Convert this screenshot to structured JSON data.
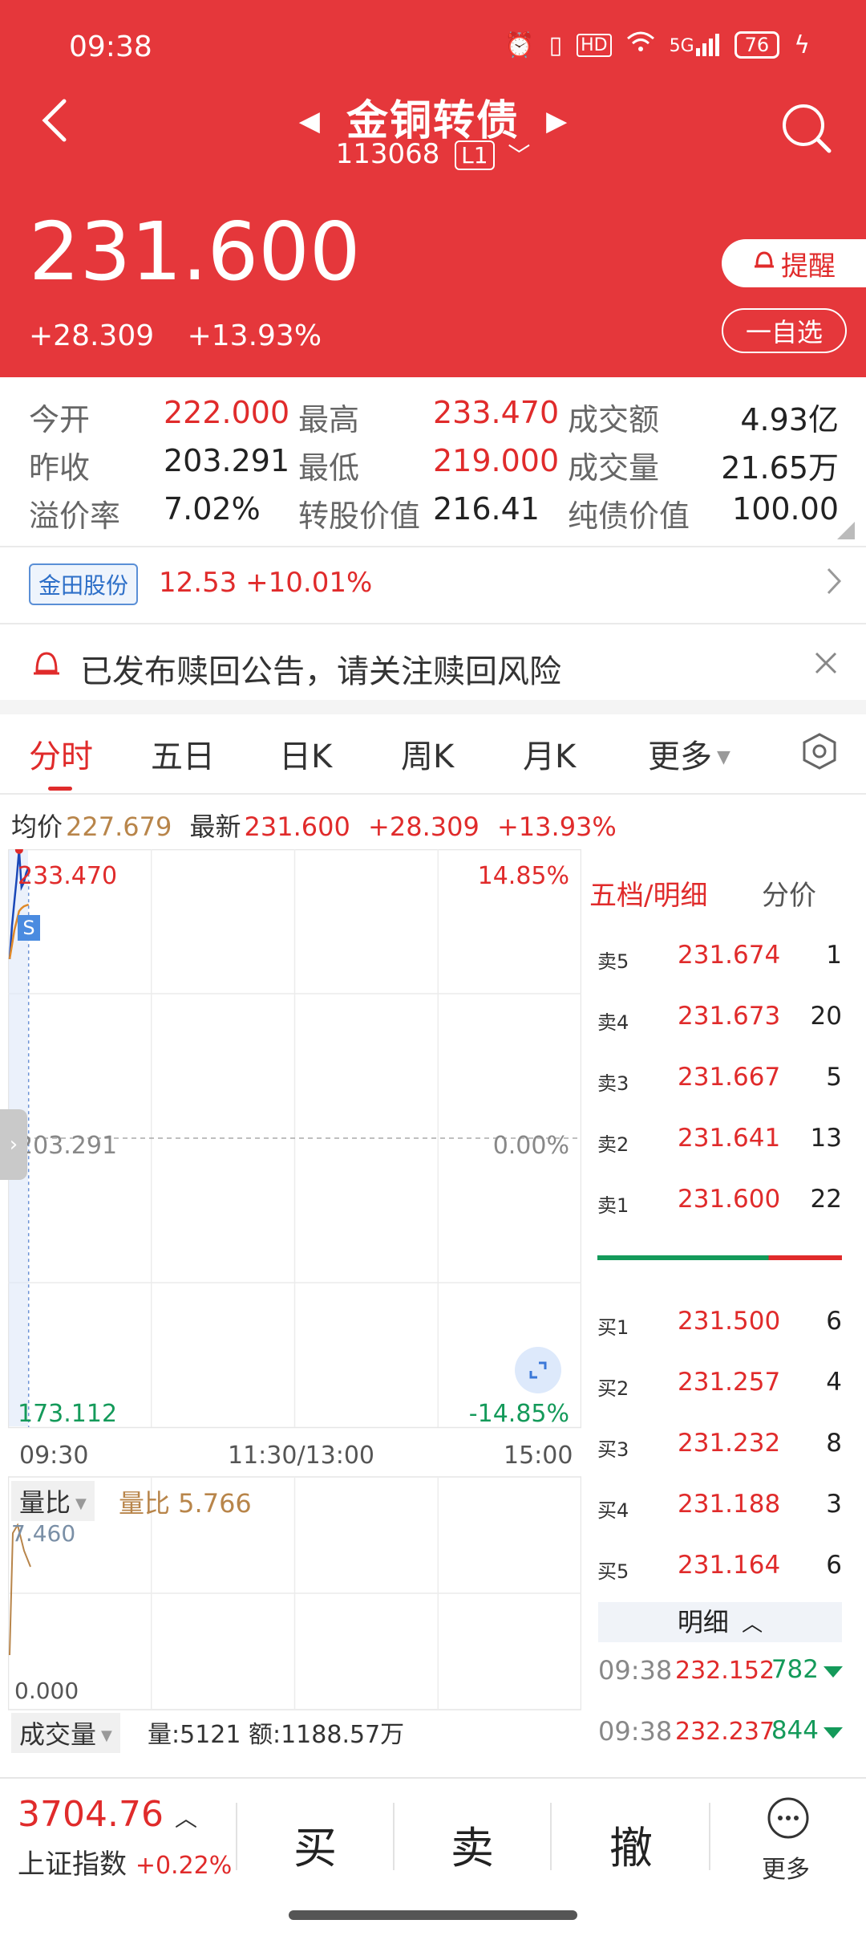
{
  "status_bar": {
    "time": "09:38",
    "net": "5G",
    "battery": "76"
  },
  "header": {
    "title": "金铜转债",
    "code": "113068",
    "level": "L1",
    "price": "231.600",
    "change": "+28.309",
    "change_pct": "+13.93%",
    "remind_label": "提醒",
    "watchlist_label": "一自选"
  },
  "stats": [
    [
      {
        "label": "今开",
        "value": "222.000",
        "color": "red"
      },
      {
        "label": "最高",
        "value": "233.470",
        "color": "red"
      },
      {
        "label": "成交额",
        "value": "4.93亿",
        "color": "black"
      }
    ],
    [
      {
        "label": "昨收",
        "value": "203.291",
        "color": "black"
      },
      {
        "label": "最低",
        "value": "219.000",
        "color": "red"
      },
      {
        "label": "成交量",
        "value": "21.65万",
        "color": "black"
      }
    ],
    [
      {
        "label": "溢价率",
        "value": "7.02%",
        "color": "black"
      },
      {
        "label": "转股价值",
        "value": "216.41",
        "color": "black"
      },
      {
        "label": "纯债价值",
        "value": "100.00",
        "color": "black"
      }
    ]
  ],
  "related_stock": {
    "name": "金田股份",
    "price": "12.53",
    "change_pct": "+10.01%"
  },
  "notice": {
    "text": "已发布赎回公告，请关注赎回风险"
  },
  "tabs": [
    "分时",
    "五日",
    "日K",
    "周K",
    "月K",
    "更多"
  ],
  "info_line": {
    "avg_label": "均价",
    "avg_value": "227.679",
    "latest_label": "最新",
    "latest_value": "231.600",
    "change": "+28.309",
    "change_pct": "+13.93%"
  },
  "chart": {
    "y_max": "233.470",
    "y_mid": "203.291",
    "y_min": "173.112",
    "pct_max": "14.85%",
    "pct_mid": "0.00%",
    "pct_min": "-14.85%",
    "t_start": "09:30",
    "t_mid": "11:30/13:00",
    "t_end": "15:00",
    "marker": "S"
  },
  "chart_data": {
    "type": "line",
    "title": "",
    "xlabel": "",
    "ylabel": "",
    "ylim": [
      173.112,
      233.47
    ],
    "x": [
      "09:30",
      "09:31",
      "09:32",
      "09:33",
      "09:34",
      "09:35",
      "09:36",
      "09:37",
      "09:38"
    ],
    "series": [
      {
        "values": [
          222.0,
          225.5,
          228.0,
          230.5,
          233.4,
          229.5,
          230.0,
          231.0,
          231.6
        ]
      },
      {
        "values": [
          222.0,
          223.5,
          225.0,
          226.0,
          227.0,
          227.3,
          227.5,
          227.6,
          227.679
        ]
      }
    ],
    "grid": true
  },
  "order_book": {
    "title": "五档/明细",
    "sub": "分价",
    "sells": [
      {
        "label": "卖5",
        "price": "231.674",
        "vol": "1"
      },
      {
        "label": "卖4",
        "price": "231.673",
        "vol": "20"
      },
      {
        "label": "卖3",
        "price": "231.667",
        "vol": "5"
      },
      {
        "label": "卖2",
        "price": "231.641",
        "vol": "13"
      },
      {
        "label": "卖1",
        "price": "231.600",
        "vol": "22"
      }
    ],
    "buys": [
      {
        "label": "买1",
        "price": "231.500",
        "vol": "6"
      },
      {
        "label": "买2",
        "price": "231.257",
        "vol": "4"
      },
      {
        "label": "买3",
        "price": "231.232",
        "vol": "8"
      },
      {
        "label": "买4",
        "price": "231.188",
        "vol": "3"
      },
      {
        "label": "买5",
        "price": "231.164",
        "vol": "6"
      }
    ],
    "buy_ratio": 0.7,
    "detail_label": "明细",
    "ticks": [
      {
        "time": "09:38",
        "price": "232.152",
        "vol": "782"
      },
      {
        "time": "09:38",
        "price": "232.237",
        "vol": "844"
      }
    ]
  },
  "volume_ratio": {
    "button": "量比",
    "value_text": "量比 5.766",
    "top": "7.460",
    "bottom": "0.000"
  },
  "volume": {
    "button": "成交量",
    "text": "量:5121 额:1188.57万"
  },
  "bottom_bar": {
    "index_value": "3704.76",
    "index_name": "上证指数",
    "index_change": "+0.22%",
    "buy": "买",
    "sell": "卖",
    "cancel": "撤",
    "more": "更多"
  },
  "colors": {
    "header_red": "#e5373b",
    "up_red": "#e02b2b",
    "down_green": "#149a5a",
    "avg_orange": "#b8854a"
  }
}
